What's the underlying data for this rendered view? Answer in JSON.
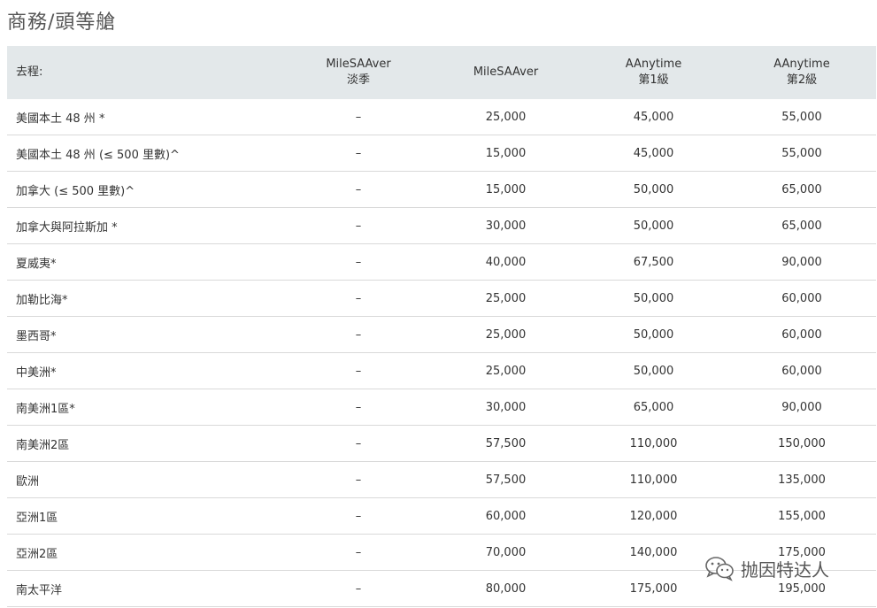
{
  "page_title": "商務/頭等艙",
  "table": {
    "headers": [
      {
        "line1": "去程:",
        "line2": ""
      },
      {
        "line1": "MileSAAver",
        "line2": "淡季"
      },
      {
        "line1": "MileSAAver",
        "line2": ""
      },
      {
        "line1": "AAnytime",
        "line2": "第1級"
      },
      {
        "line1": "AAnytime",
        "line2": "第2級"
      }
    ],
    "rows": [
      [
        "美國本土 48 州 *",
        "–",
        "25,000",
        "45,000",
        "55,000"
      ],
      [
        "美國本土 48 州 (≤ 500 里數)^",
        "–",
        "15,000",
        "45,000",
        "55,000"
      ],
      [
        "加拿大 (≤ 500 里數)^",
        "–",
        "15,000",
        "50,000",
        "65,000"
      ],
      [
        "加拿大與阿拉斯加 *",
        "–",
        "30,000",
        "50,000",
        "65,000"
      ],
      [
        "夏威夷*",
        "–",
        "40,000",
        "67,500",
        "90,000"
      ],
      [
        "加勒比海*",
        "–",
        "25,000",
        "50,000",
        "60,000"
      ],
      [
        "墨西哥*",
        "–",
        "25,000",
        "50,000",
        "60,000"
      ],
      [
        "中美洲*",
        "–",
        "25,000",
        "50,000",
        "60,000"
      ],
      [
        "南美洲1區*",
        "–",
        "30,000",
        "65,000",
        "90,000"
      ],
      [
        "南美洲2區",
        "–",
        "57,500",
        "110,000",
        "150,000"
      ],
      [
        "歐洲",
        "–",
        "57,500",
        "110,000",
        "135,000"
      ],
      [
        "亞洲1區",
        "–",
        "60,000",
        "120,000",
        "155,000"
      ],
      [
        "亞洲2區",
        "–",
        "70,000",
        "140,000",
        "175,000"
      ],
      [
        "南太平洋",
        "–",
        "80,000",
        "175,000",
        "195,000"
      ]
    ]
  },
  "watermark": {
    "text": "抛因特达人",
    "icon": "wechat-icon"
  }
}
